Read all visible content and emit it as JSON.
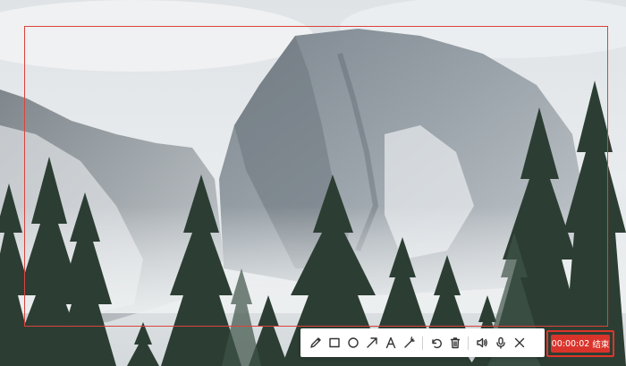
{
  "wallpaper": {
    "description_icon": "mountain-forest-wallpaper"
  },
  "capture_frame": {
    "border_color": "#d9443c"
  },
  "toolbar": {
    "tools": [
      {
        "name": "pen-tool",
        "icon": "pencil-icon"
      },
      {
        "name": "rectangle-tool",
        "icon": "square-icon"
      },
      {
        "name": "ellipse-tool",
        "icon": "circle-icon"
      },
      {
        "name": "arrow-tool",
        "icon": "arrow-icon"
      },
      {
        "name": "text-tool",
        "icon": "text-icon",
        "glyph": "A"
      },
      {
        "name": "highlighter-tool",
        "icon": "magic-wand-icon"
      },
      {
        "name": "undo-tool",
        "icon": "undo-icon"
      },
      {
        "name": "delete-tool",
        "icon": "trash-icon"
      },
      {
        "name": "speaker-tool",
        "icon": "speaker-icon"
      },
      {
        "name": "microphone-tool",
        "icon": "microphone-icon"
      },
      {
        "name": "close-tool",
        "icon": "close-icon"
      }
    ]
  },
  "recording": {
    "elapsed": "00:00:02",
    "stop_label": "结束",
    "accent": "#d9342b"
  }
}
